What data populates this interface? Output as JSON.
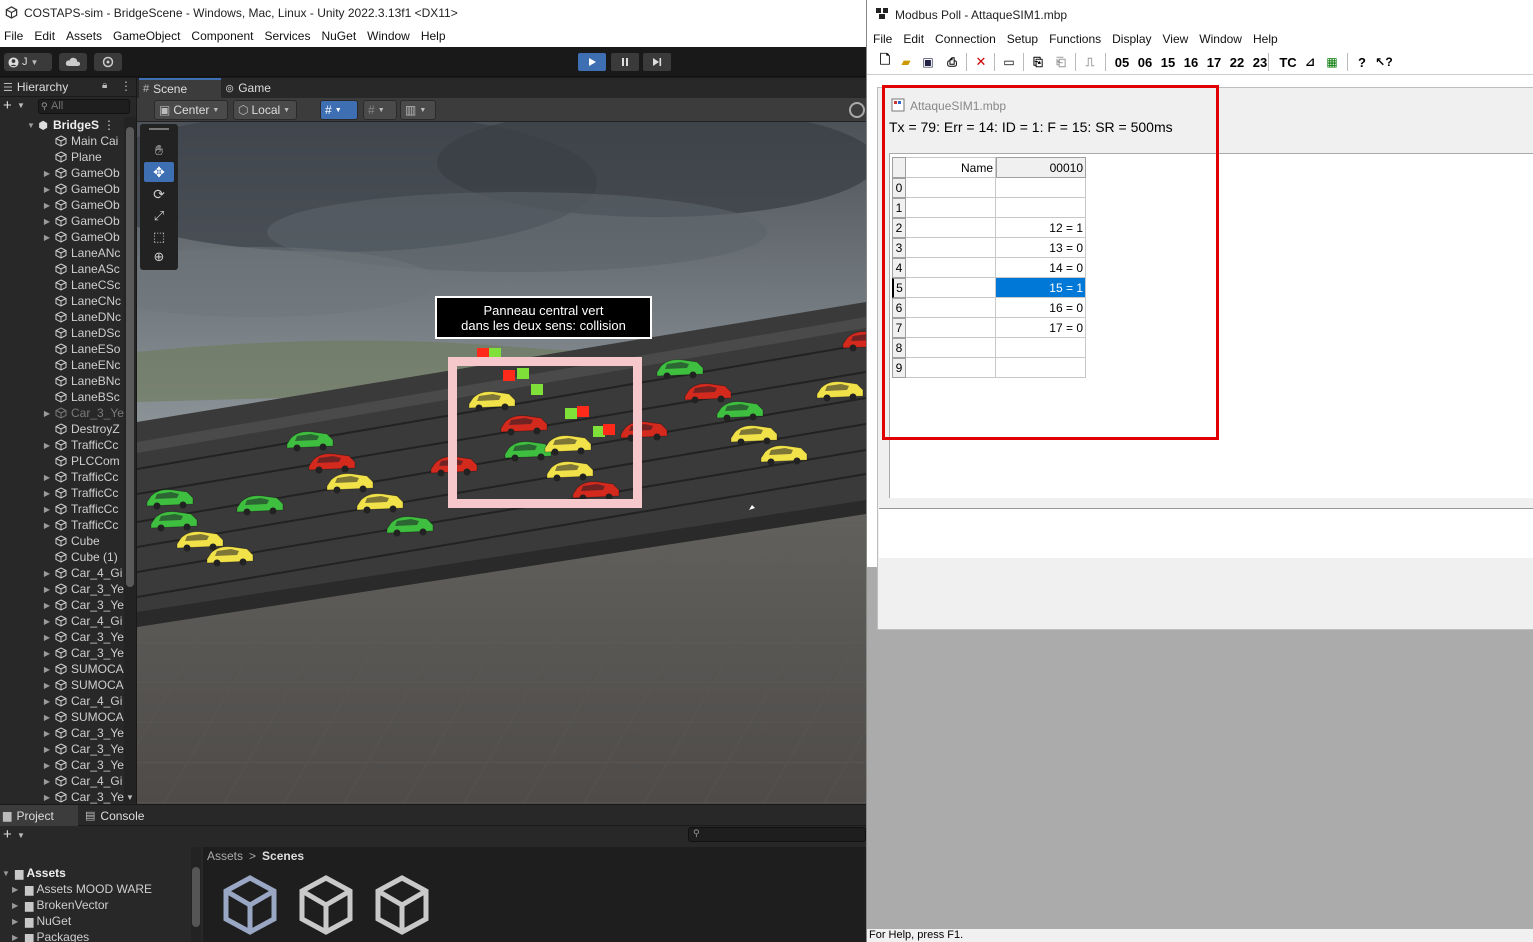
{
  "unity": {
    "window_title": "COSTAPS-sim - BridgeScene - Windows, Mac, Linux - Unity 2022.3.13f1 <DX11>",
    "menu": [
      "File",
      "Edit",
      "Assets",
      "GameObject",
      "Component",
      "Services",
      "NuGet",
      "Window",
      "Help"
    ],
    "account_label": "J",
    "hierarchy_tab": "Hierarchy",
    "search_placeholder": "All",
    "scene_tab": "Scene",
    "game_tab": "Game",
    "pivot_center": "Center",
    "pivot_local": "Local",
    "hierarchy": {
      "root": "BridgeS",
      "items": [
        {
          "label": "Main Cai",
          "arrow": false,
          "dim": false
        },
        {
          "label": "Plane",
          "arrow": false,
          "dim": false
        },
        {
          "label": "GameOb",
          "arrow": true,
          "dim": false
        },
        {
          "label": "GameOb",
          "arrow": true,
          "dim": false
        },
        {
          "label": "GameOb",
          "arrow": true,
          "dim": false
        },
        {
          "label": "GameOb",
          "arrow": true,
          "dim": false
        },
        {
          "label": "GameOb",
          "arrow": true,
          "dim": false
        },
        {
          "label": "LaneANc",
          "arrow": false,
          "dim": false
        },
        {
          "label": "LaneASc",
          "arrow": false,
          "dim": false
        },
        {
          "label": "LaneCSc",
          "arrow": false,
          "dim": false
        },
        {
          "label": "LaneCNc",
          "arrow": false,
          "dim": false
        },
        {
          "label": "LaneDNc",
          "arrow": false,
          "dim": false
        },
        {
          "label": "LaneDSc",
          "arrow": false,
          "dim": false
        },
        {
          "label": "LaneESo",
          "arrow": false,
          "dim": false
        },
        {
          "label": "LaneENc",
          "arrow": false,
          "dim": false
        },
        {
          "label": "LaneBNc",
          "arrow": false,
          "dim": false
        },
        {
          "label": "LaneBSc",
          "arrow": false,
          "dim": false
        },
        {
          "label": "Car_3_Ye",
          "arrow": true,
          "dim": true
        },
        {
          "label": "DestroyZ",
          "arrow": false,
          "dim": false
        },
        {
          "label": "TrafficCc",
          "arrow": true,
          "dim": false
        },
        {
          "label": "PLCCom",
          "arrow": false,
          "dim": false
        },
        {
          "label": "TrafficCc",
          "arrow": true,
          "dim": false
        },
        {
          "label": "TrafficCc",
          "arrow": true,
          "dim": false
        },
        {
          "label": "TrafficCc",
          "arrow": true,
          "dim": false
        },
        {
          "label": "TrafficCc",
          "arrow": true,
          "dim": false
        },
        {
          "label": "Cube",
          "arrow": false,
          "dim": false
        },
        {
          "label": "Cube (1)",
          "arrow": false,
          "dim": false
        },
        {
          "label": "Car_4_Gi",
          "arrow": true,
          "dim": false
        },
        {
          "label": "Car_3_Ye",
          "arrow": true,
          "dim": false
        },
        {
          "label": "Car_3_Ye",
          "arrow": true,
          "dim": false
        },
        {
          "label": "Car_4_Gi",
          "arrow": true,
          "dim": false
        },
        {
          "label": "Car_3_Ye",
          "arrow": true,
          "dim": false
        },
        {
          "label": "Car_3_Ye",
          "arrow": true,
          "dim": false
        },
        {
          "label": "SUMOCA",
          "arrow": true,
          "dim": false
        },
        {
          "label": "SUMOCA",
          "arrow": true,
          "dim": false
        },
        {
          "label": "Car_4_Gi",
          "arrow": true,
          "dim": false
        },
        {
          "label": "SUMOCA",
          "arrow": true,
          "dim": false
        },
        {
          "label": "Car_3_Ye",
          "arrow": true,
          "dim": false
        },
        {
          "label": "Car_3_Ye",
          "arrow": true,
          "dim": false
        },
        {
          "label": "Car_3_Ye",
          "arrow": true,
          "dim": false
        },
        {
          "label": "Car_4_Gi",
          "arrow": true,
          "dim": false
        },
        {
          "label": "Car_3_Ye",
          "arrow": true,
          "dim": false
        }
      ]
    },
    "annotation": {
      "line1": "Panneau central vert",
      "line2": "dans les deux sens: collision"
    },
    "project": {
      "project_tab": "Project",
      "console_tab": "Console",
      "tree": [
        {
          "label": "Assets",
          "bold": true,
          "indent": 0
        },
        {
          "label": "Assets MOOD WARE",
          "bold": false,
          "indent": 1
        },
        {
          "label": "BrokenVector",
          "bold": false,
          "indent": 1
        },
        {
          "label": "NuGet",
          "bold": false,
          "indent": 1
        },
        {
          "label": "Packages",
          "bold": false,
          "indent": 1
        }
      ],
      "breadcrumb_root": "Assets",
      "breadcrumb_sep": ">",
      "breadcrumb_current": "Scenes"
    },
    "colors": {
      "play_active": "#3e6fb3",
      "car_green": "#3fbf3f",
      "car_red": "#d42a1e",
      "car_yellow": "#f2e24a"
    }
  },
  "modbus": {
    "window_title": "Modbus Poll - AttaqueSIM1.mbp",
    "menu": [
      "File",
      "Edit",
      "Connection",
      "Setup",
      "Functions",
      "Display",
      "View",
      "Window",
      "Help"
    ],
    "function_codes": [
      "05",
      "06",
      "15",
      "16",
      "17",
      "22",
      "23"
    ],
    "tc_label": "TC",
    "doc_title": "AttaqueSIM1.mbp",
    "status_line": "Tx = 79: Err = 14: ID = 1: F = 15: SR = 500ms",
    "table": {
      "col_name": "Name",
      "col_address": "00010",
      "rows": [
        {
          "index": "0",
          "value": "",
          "selected": false
        },
        {
          "index": "1",
          "value": "",
          "selected": false
        },
        {
          "index": "2",
          "value": "12 = 1",
          "selected": false
        },
        {
          "index": "3",
          "value": "13 = 0",
          "selected": false
        },
        {
          "index": "4",
          "value": "14 = 0",
          "selected": false
        },
        {
          "index": "5",
          "value": "15 = 1",
          "selected": true
        },
        {
          "index": "6",
          "value": "16 = 0",
          "selected": false
        },
        {
          "index": "7",
          "value": "17 = 0",
          "selected": false
        },
        {
          "index": "8",
          "value": "",
          "selected": false
        },
        {
          "index": "9",
          "value": "",
          "selected": false
        }
      ]
    },
    "help_text": "For Help, press F1.",
    "colors": {
      "highlight": "#e00000",
      "selection": "#0078d7"
    }
  }
}
